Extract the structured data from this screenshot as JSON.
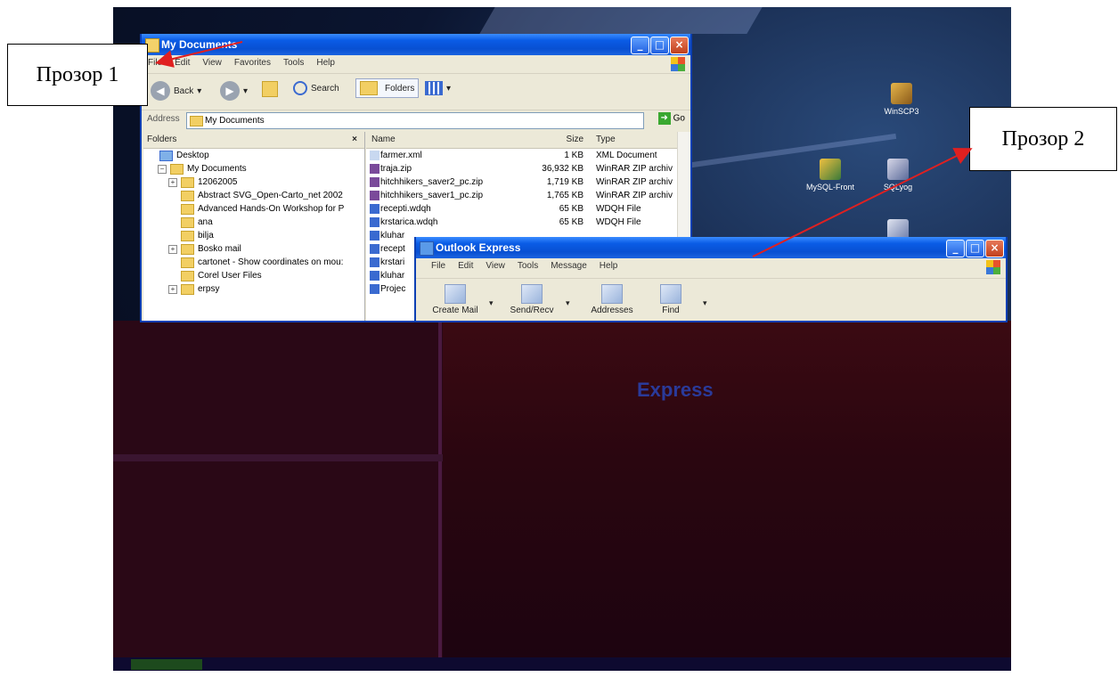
{
  "captions": {
    "box1": "Прозор 1",
    "box2": "Прозор 2"
  },
  "colors": {
    "arrow": "#e02020",
    "xp_title": "#0a5ce6",
    "desktop": "#0b1530"
  },
  "desktop": {
    "icons": [
      {
        "label": "WinSCP3",
        "icon": "winscp-icon"
      },
      {
        "label": "MySQL-Front",
        "icon": "mysql-front-icon"
      },
      {
        "label": "SQLyog",
        "icon": "sqlyog-icon"
      }
    ],
    "corrupt_word": "Express"
  },
  "explorer": {
    "title": "My Documents",
    "menu": [
      "File",
      "Edit",
      "View",
      "Favorites",
      "Tools",
      "Help"
    ],
    "toolbar": {
      "back": "Back",
      "search": "Search",
      "folders": "Folders"
    },
    "address_label": "Address",
    "address_value": "My Documents",
    "go_label": "Go",
    "folders_pane": {
      "header": "Folders",
      "close": "×",
      "tree": [
        {
          "label": "Desktop",
          "level": 0,
          "expander": ""
        },
        {
          "label": "My Documents",
          "level": 1,
          "expander": "−"
        },
        {
          "label": "12062005",
          "level": 2,
          "expander": "+"
        },
        {
          "label": "Abstract SVG_Open-Carto_net 2002",
          "level": 2,
          "expander": ""
        },
        {
          "label": "Advanced Hands-On Workshop for P",
          "level": 2,
          "expander": ""
        },
        {
          "label": "ana",
          "level": 2,
          "expander": ""
        },
        {
          "label": "bilja",
          "level": 2,
          "expander": ""
        },
        {
          "label": "Bosko mail",
          "level": 2,
          "expander": "+"
        },
        {
          "label": "cartonet - Show coordinates on mou:",
          "level": 2,
          "expander": ""
        },
        {
          "label": "Corel User Files",
          "level": 2,
          "expander": ""
        },
        {
          "label": "erpsy",
          "level": 2,
          "expander": "+"
        }
      ]
    },
    "file_list": {
      "columns": {
        "name": "Name",
        "size": "Size",
        "type": "Type"
      },
      "rows": [
        {
          "name": "farmer.xml",
          "size": "1 KB",
          "type": "XML Document",
          "icon": "xml-file-icon"
        },
        {
          "name": "traja.zip",
          "size": "36,932 KB",
          "type": "WinRAR ZIP archiv",
          "icon": "zip-file-icon"
        },
        {
          "name": "hitchhikers_saver2_pc.zip",
          "size": "1,719 KB",
          "type": "WinRAR ZIP archiv",
          "icon": "zip-file-icon"
        },
        {
          "name": "hitchhikers_saver1_pc.zip",
          "size": "1,765 KB",
          "type": "WinRAR ZIP archiv",
          "icon": "zip-file-icon"
        },
        {
          "name": "recepti.wdqh",
          "size": "65 KB",
          "type": "WDQH File",
          "icon": "wdqh-file-icon"
        },
        {
          "name": "krstarica.wdqh",
          "size": "65 KB",
          "type": "WDQH File",
          "icon": "wdqh-file-icon"
        },
        {
          "name": "kluhar",
          "size": "",
          "type": "",
          "icon": "wdqh-file-icon"
        },
        {
          "name": "recept",
          "size": "",
          "type": "",
          "icon": "wdqh-file-icon"
        },
        {
          "name": "krstari",
          "size": "",
          "type": "",
          "icon": "wdqh-file-icon"
        },
        {
          "name": "kluhar",
          "size": "",
          "type": "",
          "icon": "wdqh-file-icon"
        },
        {
          "name": "Projec",
          "size": "",
          "type": "",
          "icon": "wdqh-file-icon"
        }
      ]
    }
  },
  "outlook": {
    "title": "Outlook Express",
    "menu": [
      "File",
      "Edit",
      "View",
      "Tools",
      "Message",
      "Help"
    ],
    "toolbar": [
      {
        "label": "Create Mail",
        "icon": "create-mail-icon",
        "dropdown": true
      },
      {
        "label": "Send/Recv",
        "icon": "send-receive-icon",
        "dropdown": true
      },
      {
        "label": "Addresses",
        "icon": "address-book-icon",
        "dropdown": false
      },
      {
        "label": "Find",
        "icon": "find-icon",
        "dropdown": true
      }
    ]
  }
}
